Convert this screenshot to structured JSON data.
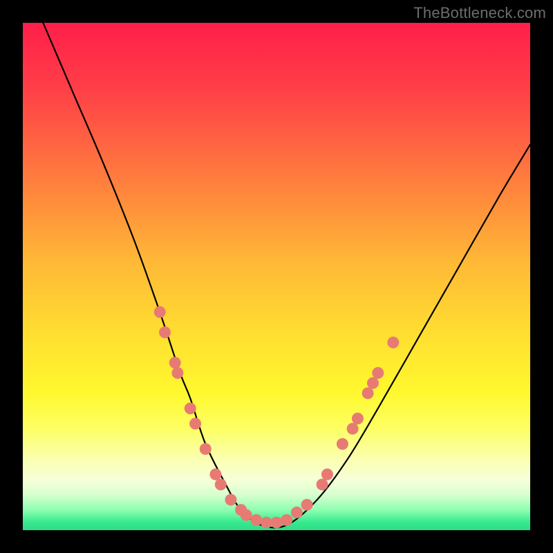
{
  "watermark": "TheBottleneck.com",
  "colors": {
    "frame": "#000000",
    "curve_stroke": "#000000",
    "dot_fill": "#e77b73",
    "gradient_top": "#ff1f4a",
    "gradient_bottom": "#2edc88"
  },
  "chart_data": {
    "type": "line",
    "title": "",
    "xlabel": "",
    "ylabel": "",
    "xlim": [
      0,
      100
    ],
    "ylim": [
      0,
      100
    ],
    "grid": false,
    "legend": "none",
    "annotations": [
      "TheBottleneck.com"
    ],
    "series": [
      {
        "name": "bottleneck-curve",
        "x": [
          4,
          10,
          16,
          22,
          27,
          31,
          33,
          36,
          40,
          43,
          47,
          52,
          58,
          64,
          70,
          78,
          86,
          94,
          100
        ],
        "values": [
          100,
          86,
          72,
          57,
          43,
          31,
          26,
          17,
          9,
          4,
          1,
          1,
          6,
          14,
          24,
          38,
          52,
          66,
          76
        ]
      }
    ],
    "data_points": [
      {
        "x": 27,
        "y": 43
      },
      {
        "x": 28,
        "y": 39
      },
      {
        "x": 30,
        "y": 33
      },
      {
        "x": 30.5,
        "y": 31
      },
      {
        "x": 33,
        "y": 24
      },
      {
        "x": 34,
        "y": 21
      },
      {
        "x": 36,
        "y": 16
      },
      {
        "x": 38,
        "y": 11
      },
      {
        "x": 39,
        "y": 9
      },
      {
        "x": 41,
        "y": 6
      },
      {
        "x": 43,
        "y": 4
      },
      {
        "x": 44,
        "y": 3
      },
      {
        "x": 46,
        "y": 2
      },
      {
        "x": 48,
        "y": 1.5
      },
      {
        "x": 50,
        "y": 1.5
      },
      {
        "x": 52,
        "y": 2
      },
      {
        "x": 54,
        "y": 3.5
      },
      {
        "x": 56,
        "y": 5
      },
      {
        "x": 59,
        "y": 9
      },
      {
        "x": 60,
        "y": 11
      },
      {
        "x": 63,
        "y": 17
      },
      {
        "x": 65,
        "y": 20
      },
      {
        "x": 66,
        "y": 22
      },
      {
        "x": 68,
        "y": 27
      },
      {
        "x": 69,
        "y": 29
      },
      {
        "x": 70,
        "y": 31
      },
      {
        "x": 73,
        "y": 37
      }
    ]
  }
}
